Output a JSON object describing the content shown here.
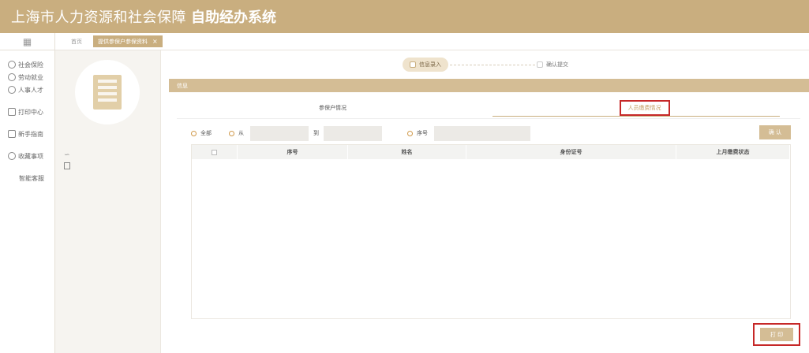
{
  "header": {
    "title_part1": "上海市人力资源和社会保障",
    "title_part2": "自助经办系统"
  },
  "sidebar": {
    "items": [
      {
        "label": "社会保险",
        "icon": "shield-icon"
      },
      {
        "label": "劳动就业",
        "icon": "person-icon"
      },
      {
        "label": "人事人才",
        "icon": "people-icon"
      },
      {
        "label": "打印中心",
        "icon": "printer-icon"
      },
      {
        "label": "新手指南",
        "icon": "guide-icon"
      },
      {
        "label": "收藏事项",
        "icon": "star-icon"
      },
      {
        "label": "智能客服",
        "icon": ""
      }
    ]
  },
  "tabs": {
    "home": "首页",
    "active": "提供参保户参保资料",
    "close": "×"
  },
  "profile": {
    "user_label": "∽"
  },
  "steps": {
    "step1": "信息录入",
    "step2": "确认提交"
  },
  "info_bar": "信息",
  "subtabs": [
    "参保户情况",
    "人员缴费情况"
  ],
  "filters": {
    "all": "全部",
    "from": "从",
    "to": "到",
    "seq": "序号"
  },
  "confirm_label": "确 认",
  "table": {
    "columns": [
      "序号",
      "姓名",
      "身份证号",
      "上月缴费状态"
    ]
  },
  "print_label": "打 印",
  "colors": {
    "brand": "#c9ae7f",
    "highlight": "#c62828"
  }
}
